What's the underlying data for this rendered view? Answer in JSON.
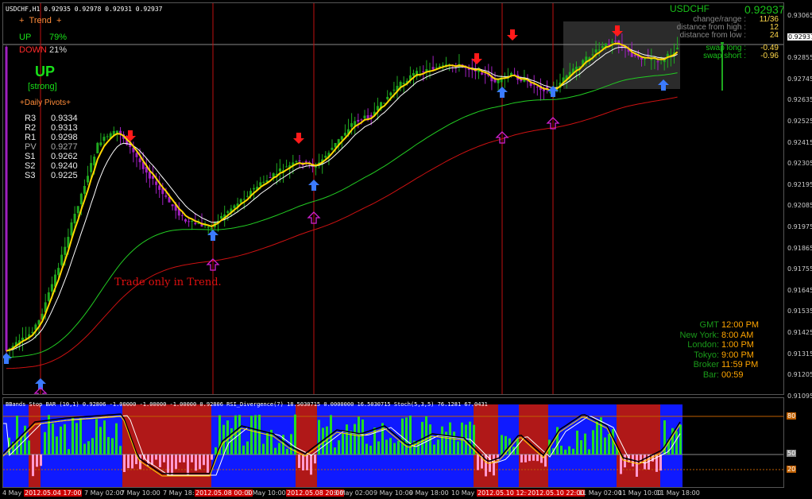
{
  "symbol_header": "USDCHF,H1",
  "ohlc": "0.92935 0.92978 0.92931 0.92937",
  "trend_panel": {
    "title": "Trend",
    "up_label": "UP",
    "up_pct": "79%",
    "down_label": "DOWN",
    "down_pct": "21%",
    "signal": "UP",
    "strength": "[strong]",
    "pivots_title": "Daily Pivots",
    "pivots": [
      {
        "name": "R3",
        "value": "0.9334"
      },
      {
        "name": "R2",
        "value": "0.9313"
      },
      {
        "name": "R1",
        "value": "0.9298"
      },
      {
        "name": "PV",
        "value": "0.9277"
      },
      {
        "name": "S1",
        "value": "0.9262"
      },
      {
        "name": "S2",
        "value": "0.9240"
      },
      {
        "name": "S3",
        "value": "0.9225"
      }
    ]
  },
  "info_panel": {
    "symbol": "USDCHF",
    "price": "0.92937",
    "rows": [
      {
        "label": "change/range :",
        "value": "11/36"
      },
      {
        "label": "distance from high :",
        "value": "12"
      },
      {
        "label": "distance from low :",
        "value": "24"
      },
      {
        "label": "swap long :",
        "value": "-0.49"
      },
      {
        "label": "swap short :",
        "value": "-0.96"
      }
    ]
  },
  "clock_panel": {
    "rows": [
      {
        "label": "GMT",
        "value": "12:00 PM"
      },
      {
        "label": "New York:",
        "value": "8:00 AM"
      },
      {
        "label": "London:",
        "value": "1:00 PM"
      },
      {
        "label": "Tokyo:",
        "value": "9:00 PM"
      },
      {
        "label": "Broker",
        "value": "11:59 PM"
      },
      {
        "label": "Bar:",
        "value": "00:59"
      }
    ]
  },
  "annotation": "Trade only in Trend.",
  "indicator_header": "BBands Stop BAR (10,1) 0.92806 -1.00000 -1.00000 -1.00000 0.92806 RSI_Divergence(7) 18.5030715 0.0000000 16.5030715 Stoch(5,3,5) 76.1281 67.0431",
  "price_scale": [
    "0.93065",
    "0.92937",
    "0.92855",
    "0.92745",
    "0.92635",
    "0.92525",
    "0.92415",
    "0.92305",
    "0.92195",
    "0.92085",
    "0.91975",
    "0.91865",
    "0.91755",
    "0.91645",
    "0.91535",
    "0.91425",
    "0.91315",
    "0.91205",
    "0.91095"
  ],
  "sub_scale": [
    "80",
    "50",
    "20"
  ],
  "time_axis": [
    {
      "label": "4 May 2012",
      "red": false
    },
    {
      "label": "2012.05.04 17:00",
      "red": true
    },
    {
      "label": "7 May 02:00",
      "red": false
    },
    {
      "label": "7 May 10:00",
      "red": false
    },
    {
      "label": "7 May 18:00",
      "red": false
    },
    {
      "label": "2012.05.08 00:00",
      "red": true
    },
    {
      "label": "8 May 10:00",
      "red": false
    },
    {
      "label": "2012.05.08 20:00",
      "red": true
    },
    {
      "label": "9 May 02:00",
      "red": false
    },
    {
      "label": "9 May 10:00",
      "red": false
    },
    {
      "label": "9 May 18:00",
      "red": false
    },
    {
      "label": "10 May 02:00",
      "red": false
    },
    {
      "label": "2012.05.10 12:00",
      "red": true
    },
    {
      "label": "2012.05.10 22:00",
      "red": true
    },
    {
      "label": "11 May 02:00",
      "red": false
    },
    {
      "label": "11 May 10:00",
      "red": false
    },
    {
      "label": "11 May 18:00",
      "red": false
    }
  ],
  "colors": {
    "bull": "#1fa81f",
    "bear": "#a020c0",
    "ema_fast": "#ffd700",
    "ema_slow": "#ffffff",
    "ma_green": "#22cc22",
    "ma_red": "#cc1111",
    "signal_up": "#3b7bff",
    "signal_down": "#ff1a1a",
    "vline": "#c01010"
  }
}
